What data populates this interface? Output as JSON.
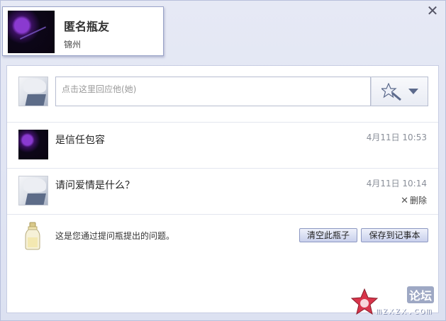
{
  "profile": {
    "name": "匿名瓶友",
    "city": "锦州"
  },
  "reply": {
    "placeholder": "点击这里回应他(她)"
  },
  "messages": [
    {
      "text": "是信任包容",
      "time": "4月11日 10:53",
      "avatar": "purple-avatar"
    },
    {
      "text": "请问爱情是什么？",
      "time": "4月11日 10:14",
      "avatar": "boy-avatar",
      "delete_label": "删除"
    }
  ],
  "footer": {
    "info": "这是您通过提问瓶提出的问题。",
    "clear_label": "清空此瓶子",
    "save_label": "保存到记事本"
  },
  "watermark": {
    "brand": "论坛",
    "url": "mzxzx.com"
  },
  "icons": {
    "close": "close-icon",
    "wand": "magic-wand-icon",
    "dropdown": "chevron-down-icon",
    "bottle": "bottle-icon"
  },
  "colors": {
    "accent": "#5c6a8c",
    "button_border": "#8d98c2",
    "time_text": "#8a8f99"
  }
}
